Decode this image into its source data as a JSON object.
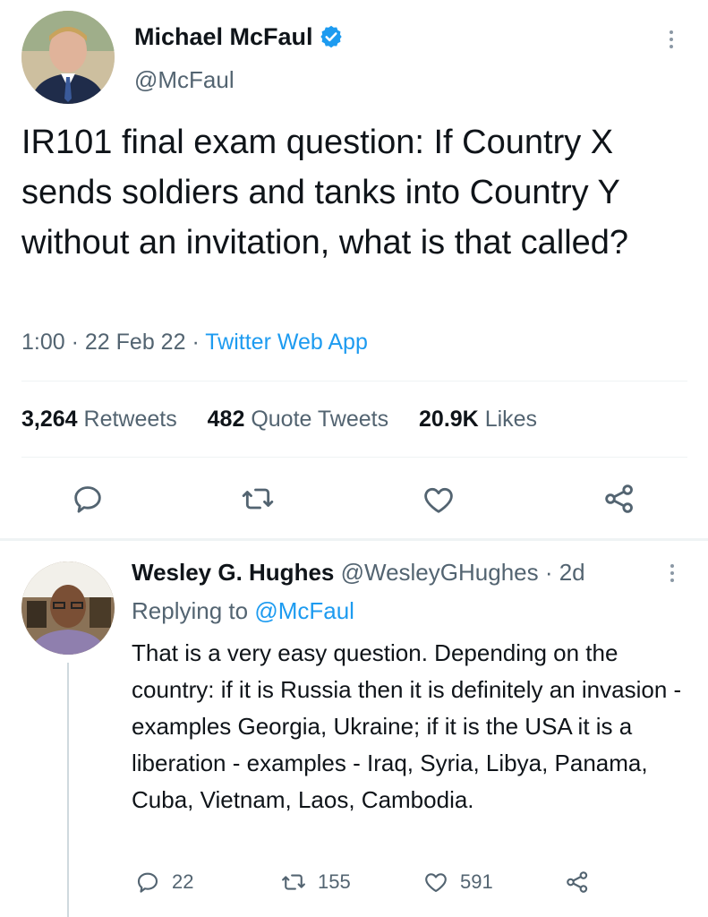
{
  "main_tweet": {
    "author_name": "Michael McFaul",
    "handle": "@McFaul",
    "text": "IR101 final exam question: If Country X sends soldiers and tanks into Country Y without an invitation, what is that called?",
    "time": "1:00",
    "date": "22 Feb 22",
    "source": "Twitter Web App",
    "stats": {
      "retweets_count": "3,264",
      "retweets_label": "Retweets",
      "quotes_count": "482",
      "quotes_label": "Quote Tweets",
      "likes_count": "20.9K",
      "likes_label": "Likes"
    }
  },
  "reply_tweet": {
    "author_name": "Wesley G. Hughes",
    "handle": "@WesleyGHughes",
    "age": "2d",
    "replying_label": "Replying to",
    "replying_to": "@McFaul",
    "text": "That is a very easy question. Depending on the country: if it is Russia then it is definitely an invasion - examples Georgia, Ukraine; if it is the USA it is a liberation - examples - Iraq, Syria, Libya, Panama, Cuba, Vietnam, Laos, Cambodia.",
    "reply_count": "22",
    "retweet_count": "155",
    "like_count": "591"
  },
  "colors": {
    "accent": "#1d9bf0",
    "muted": "#536471",
    "text": "#0f1419"
  }
}
